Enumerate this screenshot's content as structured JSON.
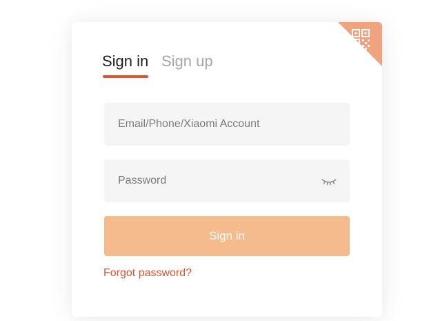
{
  "tabs": {
    "sign_in": "Sign in",
    "sign_up": "Sign up"
  },
  "form": {
    "email_placeholder": "Email/Phone/Xiaomi Account",
    "password_placeholder": "Password",
    "submit_label": "Sign in",
    "forgot_label": "Forgot password?"
  },
  "icons": {
    "corner": "qr-code-icon",
    "password_toggle": "eye-closed-icon"
  },
  "colors": {
    "accent": "#e0522d",
    "button": "#f5bb8c",
    "qr_corner": "#f0a37f",
    "field_bg": "#f5f5f5"
  }
}
